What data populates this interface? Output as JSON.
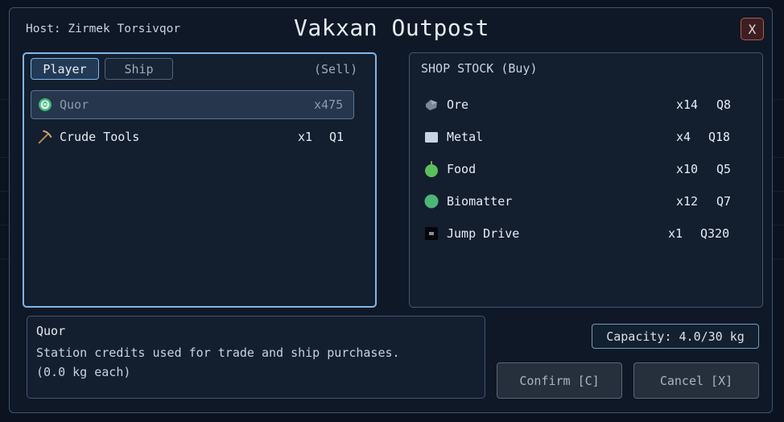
{
  "window": {
    "host_label": "Host: Zirmek Torsivqor",
    "title": "Vakxan Outpost",
    "close_label": "X"
  },
  "player_panel": {
    "tabs": [
      {
        "label": "Player",
        "active": true
      },
      {
        "label": "Ship",
        "active": false
      }
    ],
    "mode_label": "(Sell)",
    "items": [
      {
        "name": "Quor",
        "qty": "x475",
        "price": "",
        "icon": "quor-coin-icon",
        "selected": true
      },
      {
        "name": "Crude Tools",
        "qty": "x1",
        "price": "Q1",
        "icon": "pickaxe-icon",
        "selected": false
      }
    ]
  },
  "shop_panel": {
    "heading": "SHOP STOCK (Buy)",
    "items": [
      {
        "name": "Ore",
        "qty": "x14",
        "price": "Q8",
        "icon": "ore-rock-icon"
      },
      {
        "name": "Metal",
        "qty": "x4",
        "price": "Q18",
        "icon": "metal-ingot-icon"
      },
      {
        "name": "Food",
        "qty": "x10",
        "price": "Q5",
        "icon": "food-fruit-icon"
      },
      {
        "name": "Biomatter",
        "qty": "x12",
        "price": "Q7",
        "icon": "biomatter-orb-icon"
      },
      {
        "name": "Jump Drive",
        "qty": "x1",
        "price": "Q320",
        "icon": "jump-drive-chip-icon"
      }
    ]
  },
  "info": {
    "title": "Quor",
    "description": "Station credits used for trade and ship purchases.",
    "weight": "(0.0 kg each)"
  },
  "capacity_label": "Capacity: 4.0/30 kg",
  "buttons": {
    "confirm": "Confirm [C]",
    "cancel": "Cancel [X]"
  },
  "colors": {
    "accent": "#7fb8ea",
    "panel": "#131e2f",
    "background": "#0b1320",
    "close": "#b05a4e"
  }
}
